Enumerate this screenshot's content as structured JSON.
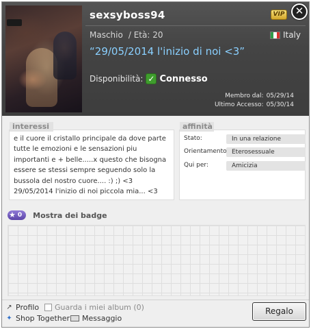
{
  "profile": {
    "username": "sexsyboss94",
    "vip_label": "VIP",
    "gender": "Maschio",
    "age_label": "/ Età: 20",
    "country": "Italy",
    "status_message": "“29/05/2014 l'inizio di noi <3”",
    "availability_label": "Disponibilità:",
    "availability_value": "Connesso",
    "member_since_label": "Membro dal:",
    "member_since_value": "05/29/14",
    "last_access_label": "Ultimo Accesso:",
    "last_access_value": "05/30/14"
  },
  "interests": {
    "tab_label": "interessi",
    "text": "e il cuore il cristallo principale da dove parte tutte le emozioni e le sensazioni piu importanti e + belle.....x questo che bisogna essere se stessi sempre seguendo solo la bussola del nostro cuore.... :) ;) <3 29/05/2014 l'inizio di noi piccola mia... <3"
  },
  "affinity": {
    "tab_label": "affinità",
    "rows": [
      {
        "label": "Stato:",
        "value": "In una relazione"
      },
      {
        "label": "Orientamento:",
        "value": "Eterosessuale"
      },
      {
        "label": "Qui per:",
        "value": "Amicizia"
      }
    ]
  },
  "badges": {
    "count": "0",
    "title": "Mostra dei badge"
  },
  "footer": {
    "profile_label": "Profilo",
    "albums_label": "Guarda i miei album (0)",
    "shop_label": "Shop Together",
    "message_label": "Messaggio",
    "gift_label": "Regalo"
  },
  "colors": {
    "header_bg": "#444444",
    "status_message": "#8ad0ff",
    "online_check": "#3f9d2d",
    "badge_accent": "#6b54b6"
  },
  "icons": {
    "close": "close-icon",
    "online": "check-icon",
    "badge": "star-icon",
    "profile": "profile-icon",
    "album": "album-icon",
    "shop": "shop-together-icon",
    "message": "mail-icon"
  }
}
